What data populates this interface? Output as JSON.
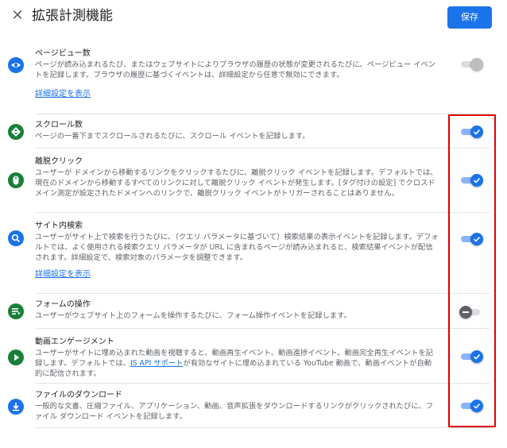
{
  "header": {
    "title": "拡張計測機能",
    "save_label": "保存",
    "close_glyph": "✕"
  },
  "accent": "#1a73e8",
  "sections": [
    {
      "key": "pageview",
      "icon": "eye-icon",
      "title": "ページビュー数",
      "desc": "ページが読み込まれるたび、またはウェブサイトによりブラウザの履歴の状態が変更されるたびに、ページビュー イベントを記録します。ブラウザの履歴に基づくイベントは、詳細設定から任意で無効にできます。",
      "link": "詳細設定を表示",
      "toggle_state": "on-disabled"
    },
    {
      "key": "scroll",
      "icon": "scroll-icon",
      "title": "スクロール数",
      "desc": "ページの一番下までスクロールされるたびに、スクロール イベントを記録します。",
      "toggle_state": "on"
    },
    {
      "key": "outbound",
      "icon": "mouse-icon",
      "title": "離脱クリック",
      "desc": "ユーザーが ドメインから移動するリンクをクリックするたびに、離脱クリック イベントを記録します。デフォルトでは、現在のドメインから移動するすべてのリンクに対して離脱クリック イベントが発生します。[タグ付けの設定] でクロスドメイン測定が設定されたドメインへのリンクで、離脱クリック イベントがトリガーされることはありません。",
      "toggle_state": "on"
    },
    {
      "key": "sitesearch",
      "icon": "search-icon",
      "title": "サイト内検索",
      "desc": "ユーザーがサイト上で検索を行うたびに、（クエリ パラメータに基づいて）検索結果の表示イベントを記録します。デフォルトでは、よく使用される検索クエリ パラメータが URL に含まれるページが読み込まれると、検索結果イベントが配信されます。詳細設定で、検索対象のパラメータを調整できます。",
      "link": "詳細設定を表示",
      "toggle_state": "on"
    },
    {
      "key": "forms",
      "icon": "form-icon",
      "title": "フォームの操作",
      "desc": "ユーザーがウェブサイト上のフォームを操作するたびに、フォーム操作イベントを記録します。",
      "toggle_state": "off"
    },
    {
      "key": "video",
      "icon": "play-icon",
      "title": "動画エンゲージメント",
      "desc_pre": "ユーザーがサイトに埋め込まれた動画を視聴すると、動画再生イベント、動画進捗イベント、動画完全再生イベントを記録します。デフォルトでは、",
      "desc_link": "JS API サポート",
      "desc_post": "が有効なサイトに埋め込まれている YouTube 動画で、動画イベントが自動的に配信されます。",
      "toggle_state": "on"
    },
    {
      "key": "download",
      "icon": "download-icon",
      "title": "ファイルのダウンロード",
      "desc": "一般的な文書、圧縮ファイル、アプリケーション、動画、音声拡張をダウンロードするリンクがクリックされたびに、ファイル ダウンロード イベントを記録します。",
      "toggle_state": "on"
    }
  ]
}
